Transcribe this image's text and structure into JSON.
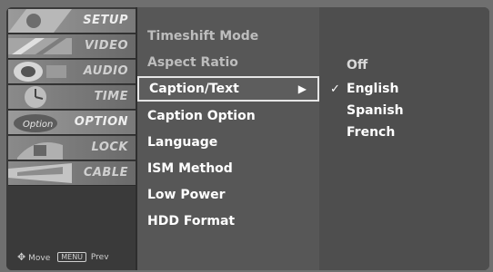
{
  "categories": [
    {
      "label": "SETUP",
      "icon": "setup-icon"
    },
    {
      "label": "VIDEO",
      "icon": "video-icon"
    },
    {
      "label": "AUDIO",
      "icon": "audio-icon"
    },
    {
      "label": "TIME",
      "icon": "time-icon"
    },
    {
      "label": "OPTION",
      "icon": "option-icon",
      "active": true
    },
    {
      "label": "LOCK",
      "icon": "lock-icon"
    },
    {
      "label": "CABLE",
      "icon": "cable-icon"
    }
  ],
  "nav": {
    "move_label": "Move",
    "prev_key": "MENU",
    "prev_label": "Prev"
  },
  "menu": {
    "items": [
      {
        "label": "Timeshift Mode",
        "state": "disabled"
      },
      {
        "label": "Aspect Ratio",
        "state": "disabled"
      },
      {
        "label": "Caption/Text",
        "state": "selected",
        "arrow": "▶"
      },
      {
        "label": "Caption Option",
        "state": "normal"
      },
      {
        "label": "Language",
        "state": "normal"
      },
      {
        "label": "ISM Method",
        "state": "normal"
      },
      {
        "label": "Low Power",
        "state": "normal"
      },
      {
        "label": "HDD Format",
        "state": "normal"
      }
    ]
  },
  "submenu": {
    "options": [
      "Off",
      "English",
      "Spanish",
      "French"
    ],
    "checked": "English",
    "check_glyph": "✓"
  }
}
